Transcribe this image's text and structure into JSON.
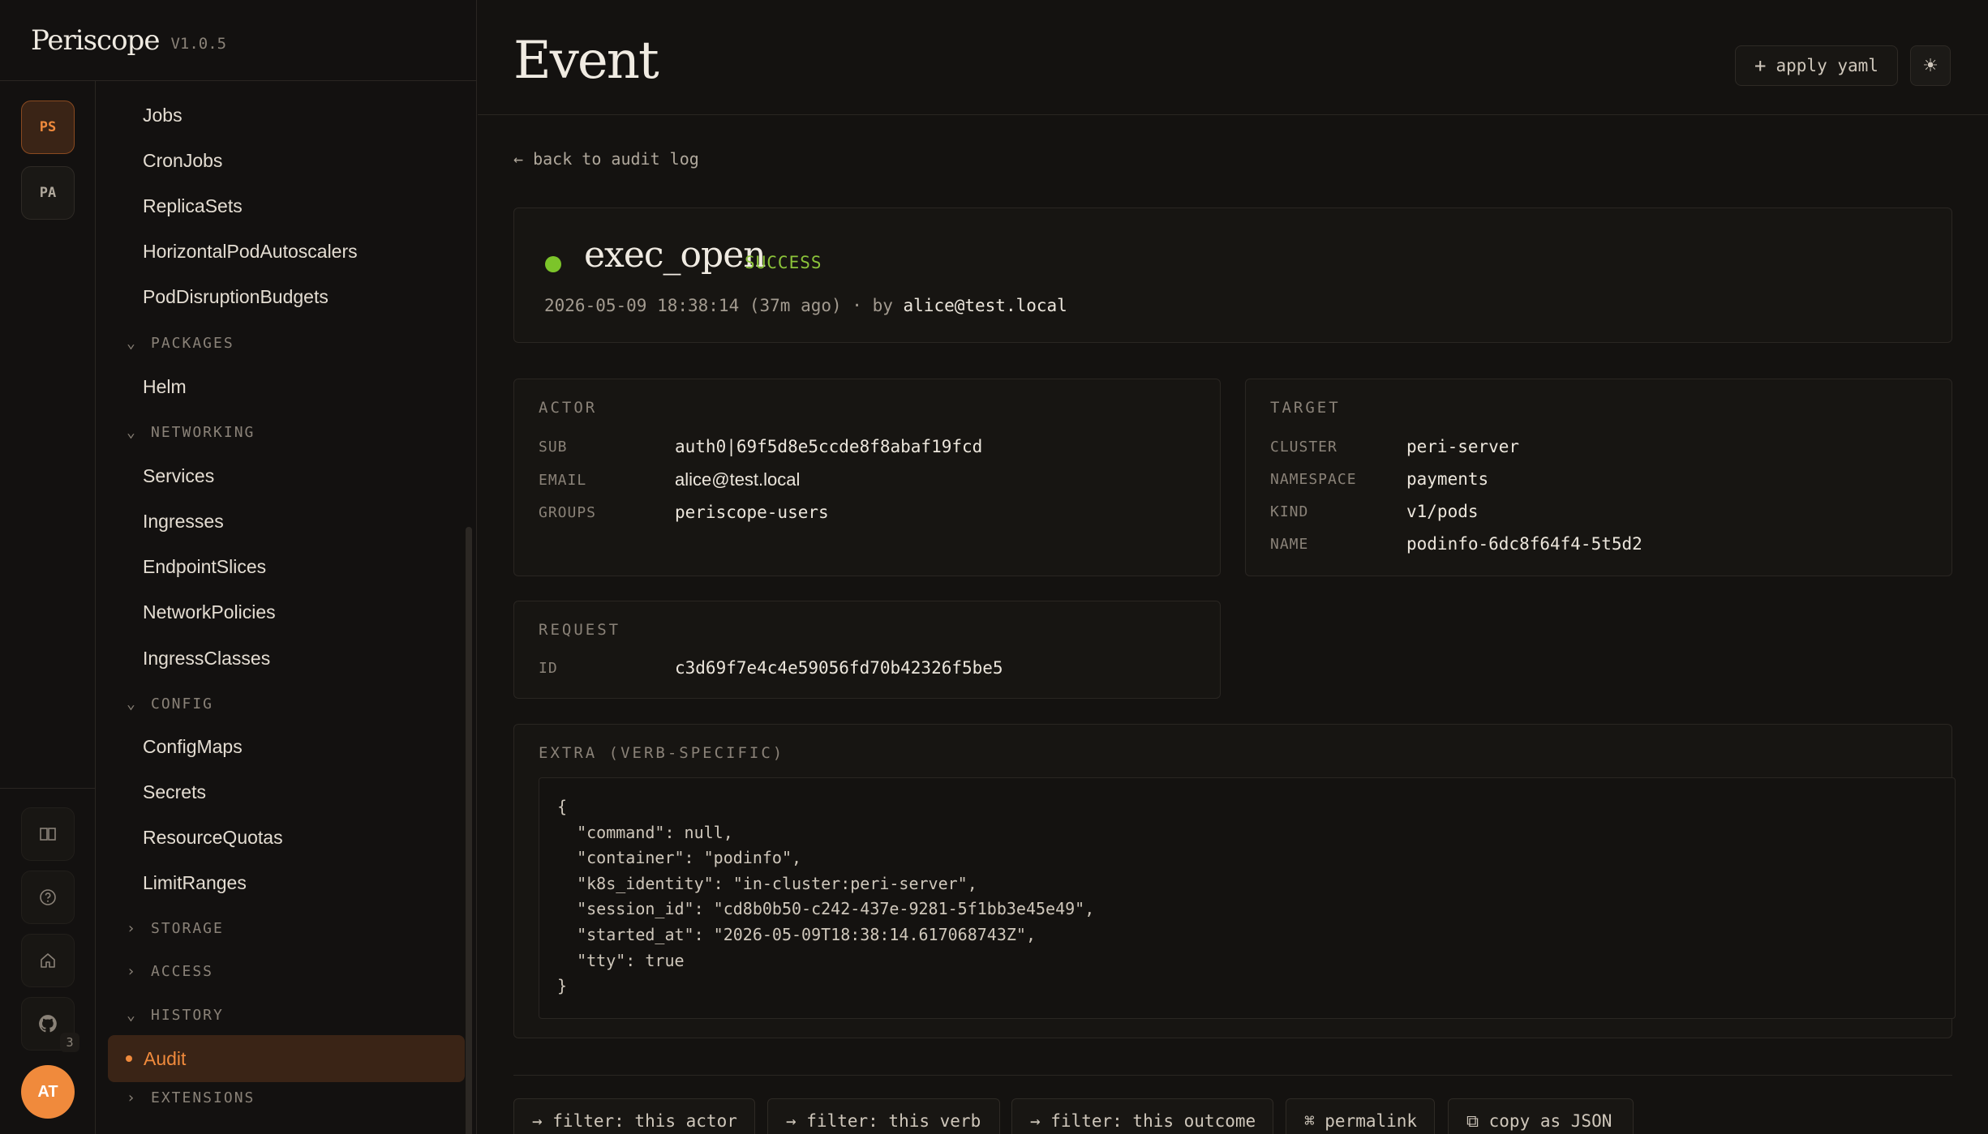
{
  "brand": {
    "name": "Periscope",
    "version": "V1.0.5"
  },
  "rail": {
    "clusters": [
      "PS",
      "PA"
    ],
    "github_badge": "3",
    "avatar": "AT"
  },
  "nav": {
    "items_top": [
      "Jobs",
      "CronJobs",
      "ReplicaSets",
      "HorizontalPodAutoscalers",
      "PodDisruptionBudgets"
    ],
    "packages": {
      "label": "PACKAGES",
      "items": [
        "Helm"
      ]
    },
    "networking": {
      "label": "NETWORKING",
      "items": [
        "Services",
        "Ingresses",
        "EndpointSlices",
        "NetworkPolicies",
        "IngressClasses"
      ]
    },
    "config": {
      "label": "CONFIG",
      "items": [
        "ConfigMaps",
        "Secrets",
        "ResourceQuotas",
        "LimitRanges"
      ]
    },
    "storage": {
      "label": "STORAGE"
    },
    "access": {
      "label": "ACCESS"
    },
    "history": {
      "label": "HISTORY",
      "active_item": "Audit"
    },
    "extensions": {
      "label": "EXTENSIONS"
    }
  },
  "header": {
    "title": "Event",
    "apply_yaml": "apply yaml",
    "apply_icon": "+"
  },
  "back_link": "← back to audit log",
  "event": {
    "verb": "exec_open",
    "outcome": "SUCCESS",
    "timestamp": "2026-05-09 18:38:14 (37m ago) · by ",
    "actor_email": "alice@test.local",
    "outcome_color": "#7cc42a"
  },
  "actor": {
    "title": "ACTOR",
    "rows": [
      {
        "key": "SUB",
        "value": "auth0|69f5d8e5ccde8f8abaf19fcd"
      },
      {
        "key": "EMAIL",
        "value": "alice@test.local"
      },
      {
        "key": "GROUPS",
        "value": "periscope-users"
      }
    ]
  },
  "target": {
    "title": "TARGET",
    "rows": [
      {
        "key": "CLUSTER",
        "value": "peri-server"
      },
      {
        "key": "NAMESPACE",
        "value": "payments"
      },
      {
        "key": "KIND",
        "value": "v1/pods"
      },
      {
        "key": "NAME",
        "value": "podinfo-6dc8f64f4-5t5d2"
      }
    ]
  },
  "request": {
    "title": "REQUEST",
    "rows": [
      {
        "key": "ID",
        "value": "c3d69f7e4c4e59056fd70b42326f5be5"
      }
    ]
  },
  "extra": {
    "title": "EXTRA (VERB-SPECIFIC)",
    "json": "{\n  \"command\": null,\n  \"container\": \"podinfo\",\n  \"k8s_identity\": \"in-cluster:peri-server\",\n  \"session_id\": \"cd8b0b50-c242-437e-9281-5f1bb3e45e49\",\n  \"started_at\": \"2026-05-09T18:38:14.617068743Z\",\n  \"tty\": true\n}"
  },
  "actions": [
    "→ filter: this actor",
    "→ filter: this verb",
    "→ filter: this outcome",
    "⌘ permalink",
    "⧉ copy as JSON"
  ]
}
